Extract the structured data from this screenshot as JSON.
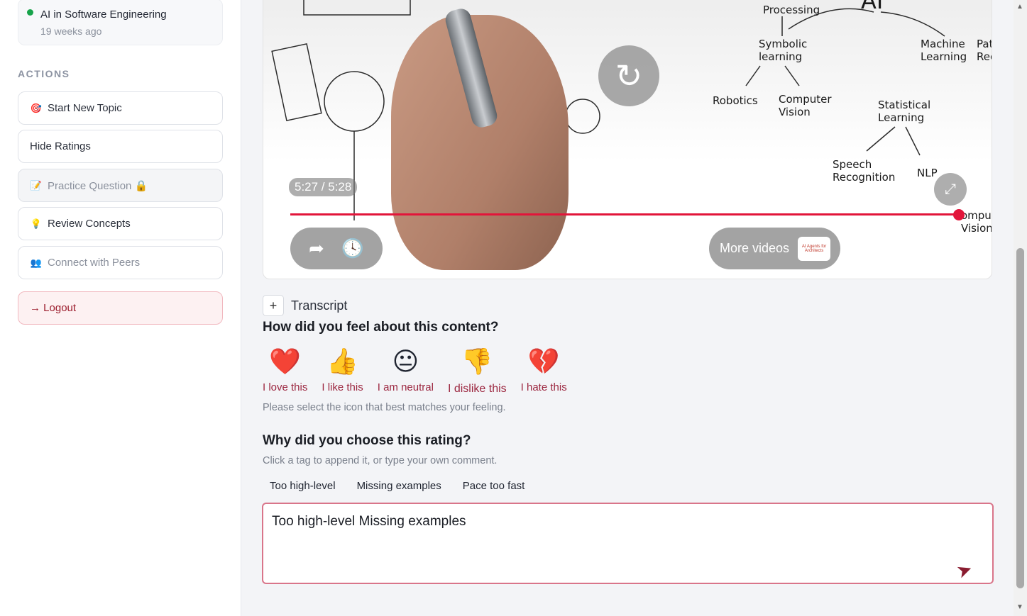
{
  "sidebar": {
    "topic": {
      "title": "AI in Software Engineering",
      "subtitle": "19 weeks ago",
      "status_color": "#17a34a"
    },
    "actions_heading": "ACTIONS",
    "actions": [
      {
        "label": "Start New Topic",
        "icon": "🎯",
        "disabled": false
      },
      {
        "label": "Hide Ratings",
        "icon": "",
        "disabled": false
      },
      {
        "label": "Practice Question 🔒",
        "icon": "📝",
        "disabled": true
      },
      {
        "label": "Review Concepts",
        "icon": "💡",
        "disabled": false
      },
      {
        "label": "Connect with Peers",
        "icon": "👥",
        "disabled": false
      }
    ],
    "logout_label": "→ Logout"
  },
  "video": {
    "time": "5:27 / 5:28",
    "more_videos_label": "More videos",
    "thumb_text": "AI Agents for Architects",
    "progress": 0.997,
    "labels": {
      "processing": "Processing",
      "ai": "AI",
      "symbolic": "Symbolic\nlearning",
      "machine": "Machine\nLearning",
      "pat": "Pat\nRec",
      "robotics": "Robotics",
      "computer_vision": "Computer\nVision",
      "statistical": "Statistical\nLearning",
      "speech": "Speech\nRecognition",
      "nlp": "NLP",
      "computer_vision2": "omputer\nVision"
    }
  },
  "transcript_label": "Transcript",
  "feeling": {
    "question": "How did you feel about this content?",
    "options": [
      {
        "emoji": "❤️",
        "label": "I love this"
      },
      {
        "emoji": "👍",
        "label": "I like this"
      },
      {
        "emoji": "😐",
        "label": "I am neutral"
      },
      {
        "emoji": "👎",
        "label": "I dislike this"
      },
      {
        "emoji": "💔",
        "label": "I hate this"
      }
    ],
    "hint": "Please select the icon that best matches your feeling."
  },
  "reason": {
    "question": "Why did you choose this rating?",
    "hint": "Click a tag to append it, or type your own comment.",
    "tags": [
      "Too high-level",
      "Missing examples",
      "Pace too fast"
    ],
    "comment_value": "Too high-level Missing examples"
  }
}
